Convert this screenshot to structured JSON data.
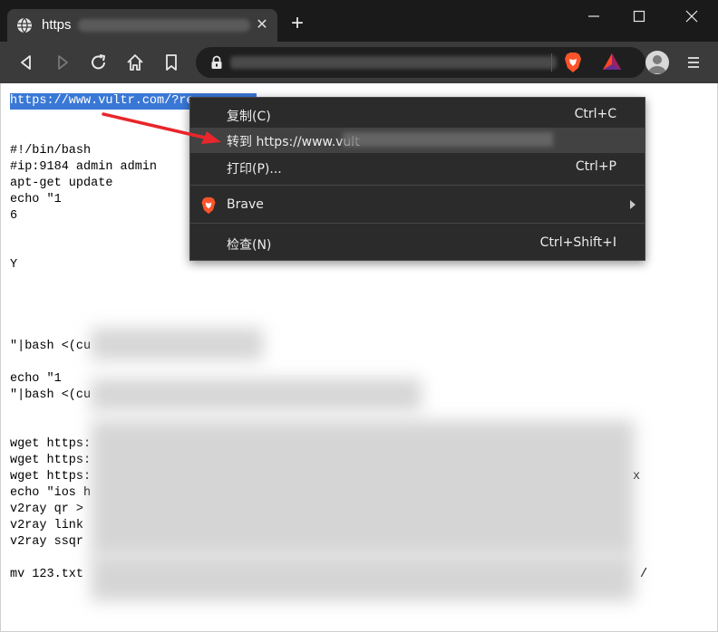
{
  "tab": {
    "title": "https",
    "close_label": "✕",
    "new_tab_label": "+"
  },
  "window_controls": {
    "minimize": "—",
    "maximize": "☐",
    "close": "✕"
  },
  "toolbar": {
    "icons": [
      "back-icon",
      "forward-icon",
      "reload-icon",
      "home-icon",
      "bookmark-icon",
      "lock-icon",
      "brave-shields-icon",
      "brave-rewards-icon",
      "profile-avatar-icon",
      "menu-icon"
    ]
  },
  "content": {
    "selected_link": "https://www.vultr.com/?re",
    "lines": [
      "#!/bin/bash",
      "#ip:9184 admin admin",
      "apt-get update",
      "echo \"1",
      "6",
      "Y",
      "\"|bash <(cu",
      "echo \"1",
      "\"|bash <(cu",
      "wget https:",
      "wget https:",
      "wget https:",
      "echo \"ios h",
      "v2ray qr >",
      "v2ray link",
      "v2ray ssqr",
      "mv 123.txt"
    ],
    "trailing": {
      "line3_end": "x",
      "mv_end": "/"
    }
  },
  "context_menu": {
    "items": [
      {
        "label": "复制(C)",
        "shortcut": "Ctrl+C"
      },
      {
        "label": "转到 https://www.vult",
        "shortcut": ""
      },
      {
        "label": "打印(P)...",
        "shortcut": "Ctrl+P"
      },
      {
        "label": "Brave",
        "shortcut": ""
      },
      {
        "label": "检查(N)",
        "shortcut": "Ctrl+Shift+I"
      }
    ]
  },
  "colors": {
    "tabstrip": "#1a1a1a",
    "toolbar": "#3b3b3b",
    "selection": "#3a78d6",
    "brave_orange": "#fb542b",
    "annotation_red": "#e8262b"
  }
}
